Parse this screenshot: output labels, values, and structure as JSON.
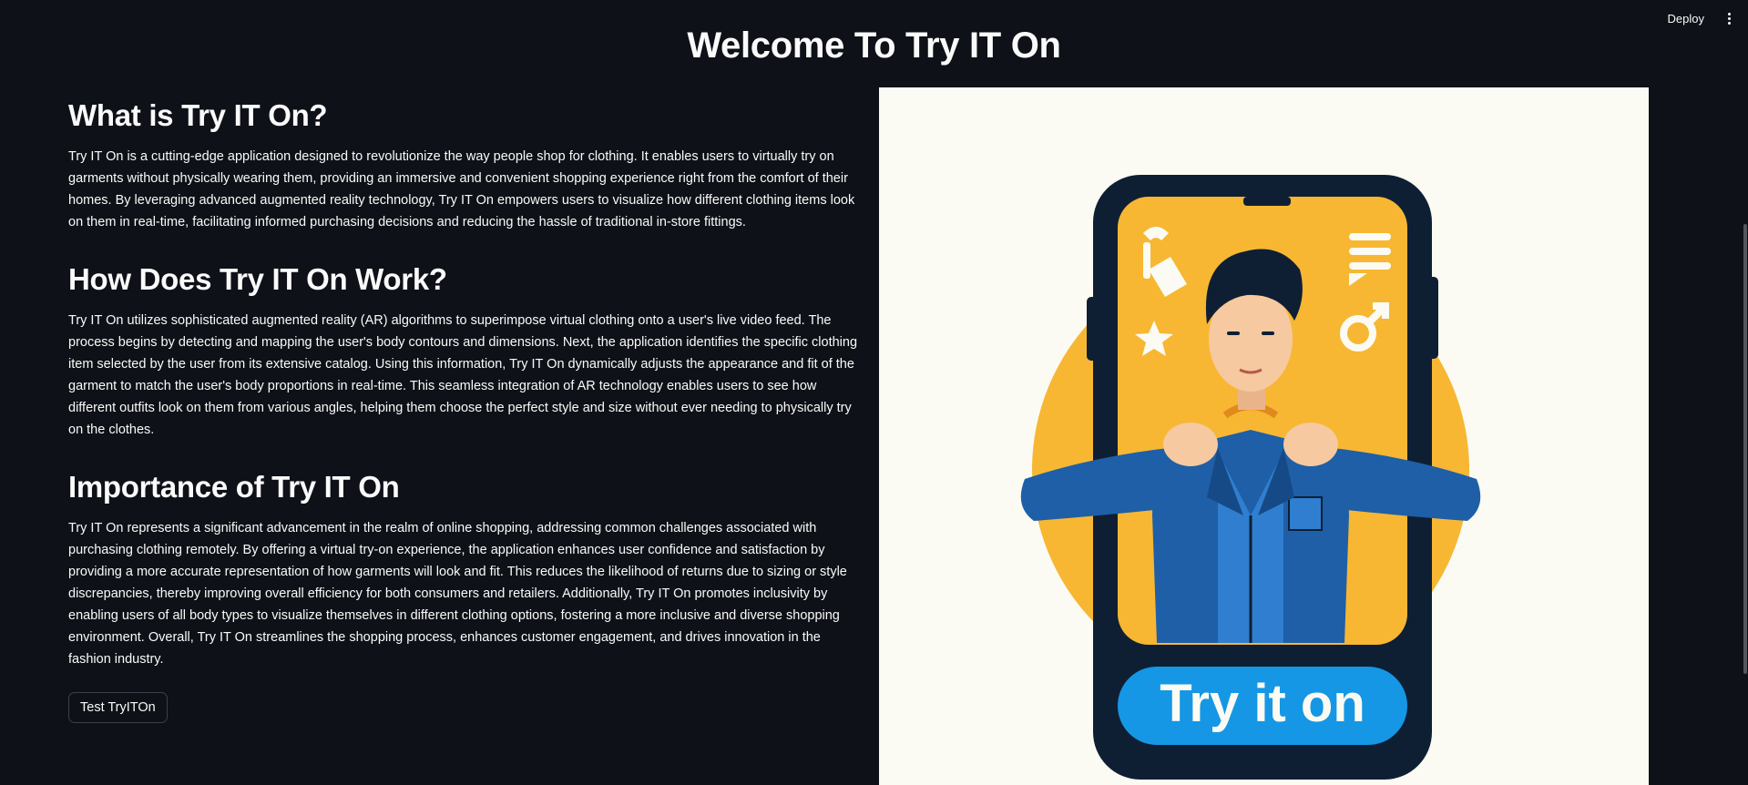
{
  "topbar": {
    "deploy_label": "Deploy",
    "menu_icon": "kebab-menu-icon"
  },
  "page": {
    "title": "Welcome To Try IT On"
  },
  "sections": [
    {
      "heading": "What is Try IT On?",
      "body": "Try IT On is a cutting-edge application designed to revolutionize the way people shop for clothing. It enables users to virtually try on garments without physically wearing them, providing an immersive and convenient shopping experience right from the comfort of their homes. By leveraging advanced augmented reality technology, Try IT On empowers users to visualize how different clothing items look on them in real-time, facilitating informed purchasing decisions and reducing the hassle of traditional in-store fittings."
    },
    {
      "heading": "How Does Try IT On Work?",
      "body": "Try IT On utilizes sophisticated augmented reality (AR) algorithms to superimpose virtual clothing onto a user's live video feed. The process begins by detecting and mapping the user's body contours and dimensions. Next, the application identifies the specific clothing item selected by the user from its extensive catalog. Using this information, Try IT On dynamically adjusts the appearance and fit of the garment to match the user's body proportions in real-time. This seamless integration of AR technology enables users to see how different outfits look on them from various angles, helping them choose the perfect style and size without ever needing to physically try on the clothes."
    },
    {
      "heading": "Importance of Try IT On",
      "body": "Try IT On represents a significant advancement in the realm of online shopping, addressing common challenges associated with purchasing clothing remotely. By offering a virtual try-on experience, the application enhances user confidence and satisfaction by providing a more accurate representation of how garments will look and fit. This reduces the likelihood of returns due to sizing or style discrepancies, thereby improving overall efficiency for both consumers and retailers. Additionally, Try IT On promotes inclusivity by enabling users of all body types to visualize themselves in different clothing options, fostering a more inclusive and diverse shopping environment. Overall, Try IT On streamlines the shopping process, enhances customer engagement, and drives innovation in the fashion industry."
    }
  ],
  "cta": {
    "label": "Test TryITOn"
  },
  "hero_image": {
    "button_text": "Try it on",
    "colors": {
      "background": "#fbfbf3",
      "phone_frame": "#0f1f33",
      "screen": "#f7b733",
      "accent_blue": "#1597e5",
      "jacket": "#1e5fa8",
      "shirt": "#2f7ed0"
    }
  },
  "theme": {
    "background": "#0e1117",
    "text": "#fafafa",
    "button_border": "#3d4049",
    "scrollbar": "#53565e"
  }
}
